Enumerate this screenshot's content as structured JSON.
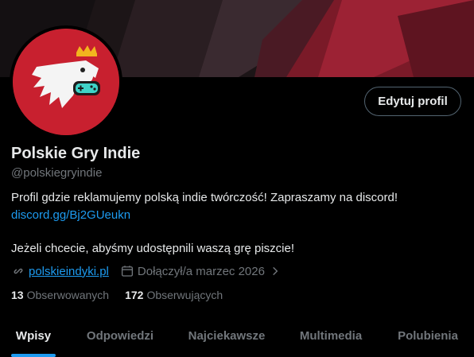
{
  "profile": {
    "name": "Polskie Gry Indie",
    "handle": "@polskiegryindie",
    "edit_button": "Edytuj profil",
    "bio_line1": "Profil gdzie reklamujemy polską indie twórczość! Zapraszamy na discord!",
    "bio_link": "discord.gg/Bj2GUeukn",
    "bio_line2": "Jeżeli chcecie, abyśmy udostępnili waszą grę piszcie!",
    "website": "polskieindyki.pl",
    "joined": "Dołączył/a marzec 2026"
  },
  "stats": {
    "following_count": "13",
    "following_label": "Obserwowanych",
    "followers_count": "172",
    "followers_label": "Obserwujących"
  },
  "tabs": [
    {
      "label": "Wpisy",
      "active": true
    },
    {
      "label": "Odpowiedzi",
      "active": false
    },
    {
      "label": "Najciekawsze",
      "active": false
    },
    {
      "label": "Multimedia",
      "active": false
    },
    {
      "label": "Polubienia",
      "active": false
    }
  ],
  "colors": {
    "background": "#000000",
    "accent": "#1d9bf0",
    "avatar_red": "#c8202f",
    "muted": "#71767b"
  },
  "icons": [
    "link-icon",
    "calendar-icon",
    "chevron-right-icon",
    "eagle-logo",
    "gamepad-icon",
    "crown-icon"
  ]
}
